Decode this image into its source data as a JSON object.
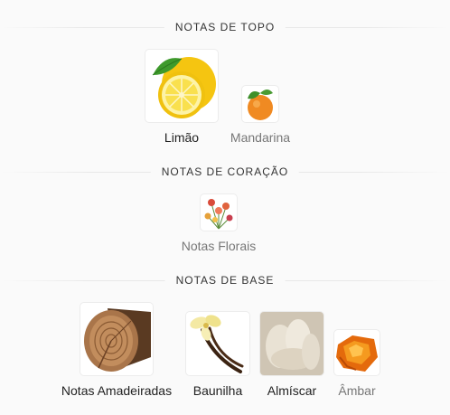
{
  "sections": [
    {
      "title": "NOTAS DE TOPO",
      "notes": [
        {
          "label": "Limão",
          "icon": "lemon-icon"
        },
        {
          "label": "Mandarina",
          "icon": "mandarin-icon"
        }
      ]
    },
    {
      "title": "NOTAS DE CORAÇÃO",
      "notes": [
        {
          "label": "Notas Florais",
          "icon": "flowers-icon"
        }
      ]
    },
    {
      "title": "NOTAS DE BASE",
      "notes": [
        {
          "label": "Notas Amadeiradas",
          "icon": "wood-icon"
        },
        {
          "label": "Baunilha",
          "icon": "vanilla-icon"
        },
        {
          "label": "Almíscar",
          "icon": "musk-icon"
        },
        {
          "label": "Âmbar",
          "icon": "amber-icon"
        }
      ]
    }
  ]
}
